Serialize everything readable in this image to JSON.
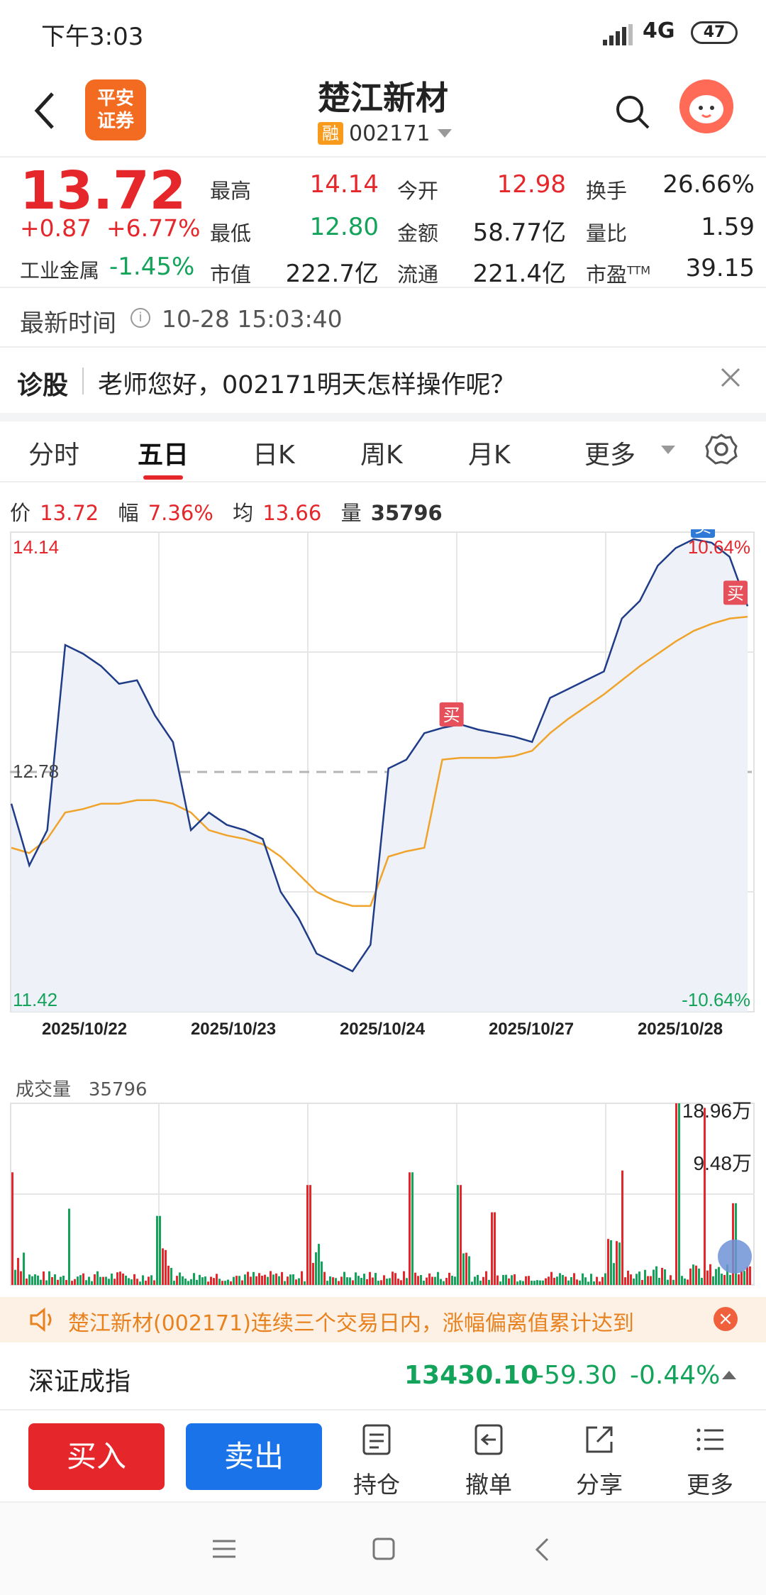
{
  "status": {
    "time": "下午3:03",
    "network": "4G",
    "battery": "47"
  },
  "header": {
    "title": "楚江新材",
    "margin_badge": "融",
    "code": "002171",
    "logo_text": "平安证券"
  },
  "quote": {
    "price": "13.72",
    "change": "+0.87",
    "change_pct": "+6.77%",
    "sector_name": "工业金属",
    "sector_pct": "-1.45%",
    "fields": [
      {
        "label": "最高",
        "value": "14.14",
        "color": "#e5262a"
      },
      {
        "label": "今开",
        "value": "12.98",
        "color": "#e5262a"
      },
      {
        "label": "换手",
        "value": "26.66%",
        "color": "#222222"
      },
      {
        "label": "最低",
        "value": "12.80",
        "color": "#14a35a"
      },
      {
        "label": "金额",
        "value": "58.77亿",
        "color": "#222222"
      },
      {
        "label": "量比",
        "value": "1.59",
        "color": "#222222"
      },
      {
        "label": "市值",
        "value": "222.7亿",
        "color": "#222222"
      },
      {
        "label": "流通",
        "value": "221.4亿",
        "color": "#222222"
      },
      {
        "label": "市盈",
        "value": "39.15",
        "color": "#222222",
        "sup": "TTM"
      }
    ]
  },
  "latest": {
    "label": "最新时间",
    "time": "10-28 15:03:40"
  },
  "diagnose": {
    "label": "诊股",
    "question": "老师您好，002171明天怎样操作呢？"
  },
  "tabs": [
    "分时",
    "五日",
    "日K",
    "周K",
    "月K",
    "更多"
  ],
  "active_tab": "五日",
  "info": {
    "price_label": "价",
    "price": "13.72",
    "amp_label": "幅",
    "amp": "7.36%",
    "avg_label": "均",
    "avg": "13.66",
    "vol_label": "量",
    "vol": "35796"
  },
  "chart_data": {
    "type": "line",
    "dates": [
      "2025/10/22",
      "2025/10/23",
      "2025/10/24",
      "2025/10/27",
      "2025/10/28"
    ],
    "ylim": [
      11.42,
      14.14
    ],
    "y_top_label": "14.14",
    "y_mid_label": "12.78",
    "y_bottom_label": "11.42",
    "pct_top": "10.64%",
    "pct_bottom": "-10.64%",
    "reference": 12.78,
    "series": [
      {
        "values": [
          12.6,
          12.25,
          12.45,
          13.5,
          13.45,
          13.38,
          13.28,
          13.3,
          13.1,
          12.95,
          12.45,
          12.55,
          12.48,
          12.45,
          12.4,
          12.1,
          11.95,
          11.75,
          11.7,
          11.65,
          11.8,
          12.8,
          12.85,
          13.0,
          13.03,
          13.05,
          13.02,
          13.0,
          12.98,
          12.95,
          13.2,
          13.25,
          13.3,
          13.35,
          13.65,
          13.75,
          13.95,
          14.05,
          14.1,
          14.08,
          14.0,
          13.72
        ]
      },
      {
        "values": [
          12.35,
          12.32,
          12.4,
          12.55,
          12.57,
          12.6,
          12.6,
          12.62,
          12.62,
          12.6,
          12.55,
          12.45,
          12.42,
          12.4,
          12.37,
          12.3,
          12.2,
          12.1,
          12.05,
          12.02,
          12.02,
          12.3,
          12.33,
          12.35,
          12.85,
          12.86,
          12.86,
          12.86,
          12.87,
          12.9,
          13.0,
          13.08,
          13.15,
          13.22,
          13.3,
          13.38,
          13.45,
          13.52,
          13.58,
          13.62,
          13.65,
          13.66
        ]
      }
    ],
    "annotations": [
      {
        "text": "买"
      },
      {
        "text": "卖"
      },
      {
        "text": "买"
      }
    ]
  },
  "volume": {
    "label": "成交量",
    "value": "35796",
    "max_label": "18.96万",
    "mid_label": "9.48万"
  },
  "banner": {
    "text": "楚江新材(002171)连续三个交易日内，涨幅偏离值累计达到"
  },
  "index": {
    "name": "深证成指",
    "value": "13430.10",
    "change": "-59.30",
    "pct": "-0.44%"
  },
  "trade": {
    "buy": "买入",
    "sell": "卖出",
    "tools": [
      "持仓",
      "撤单",
      "分享",
      "更多"
    ]
  },
  "colors": {
    "up": "#e5262a",
    "down": "#14a35a",
    "price_line": "#1f3c88",
    "avg_line": "#f0a32a",
    "accent": "#1a73e8"
  }
}
